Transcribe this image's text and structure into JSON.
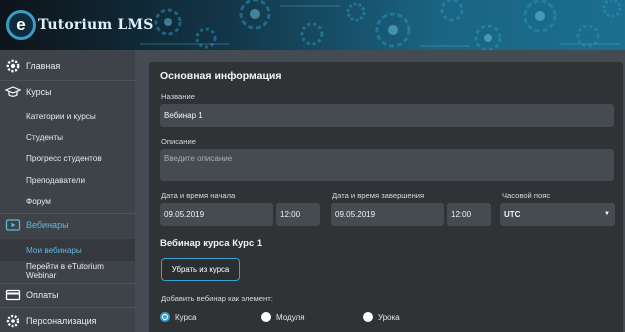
{
  "header": {
    "logo_mark": "e",
    "logo_text": "Tutorium LMS"
  },
  "sidebar": {
    "items": [
      {
        "label": "Главная",
        "icon": "gear-icon"
      },
      {
        "label": "Курсы",
        "icon": "graduation-cap-icon"
      },
      {
        "label": "Категории и курсы"
      },
      {
        "label": "Студенты"
      },
      {
        "label": "Прогресс студентов"
      },
      {
        "label": "Преподаватели"
      },
      {
        "label": "Форум"
      },
      {
        "label": "Вебинары",
        "icon": "play-icon"
      },
      {
        "label": "Мои вебинары"
      },
      {
        "label": "Перейти в eTutorium Webinar"
      },
      {
        "label": "Оплаты",
        "icon": "credit-card-icon"
      },
      {
        "label": "Персонализация",
        "icon": "settings-icon"
      }
    ]
  },
  "form": {
    "title": "Основная информация",
    "name_label": "Название",
    "name_value": "Вебинар 1",
    "description_label": "Описание",
    "description_placeholder": "Введите описание",
    "start_label": "Дата и время начала",
    "start_date": "09.05.2019",
    "start_time": "12:00",
    "end_label": "Дата и время завершения",
    "end_date": "09.05.2019",
    "end_time": "12:00",
    "timezone_label": "Часовой пояс",
    "timezone_value": "UTC",
    "course_section_title": "Вебинар курса Курс 1",
    "remove_button": "Убрать из курса",
    "add_as_label": "Добавить вебинар как элемент:",
    "radio_options": [
      "Курса",
      "Модуля",
      "Урока"
    ],
    "radio_selected": "Курса"
  },
  "colors": {
    "accent": "#3aa3d4",
    "active_text": "#5fb7de",
    "sidebar_bg": "#3d4348",
    "panel_bg": "#2f3336",
    "field_bg": "#454b50"
  }
}
